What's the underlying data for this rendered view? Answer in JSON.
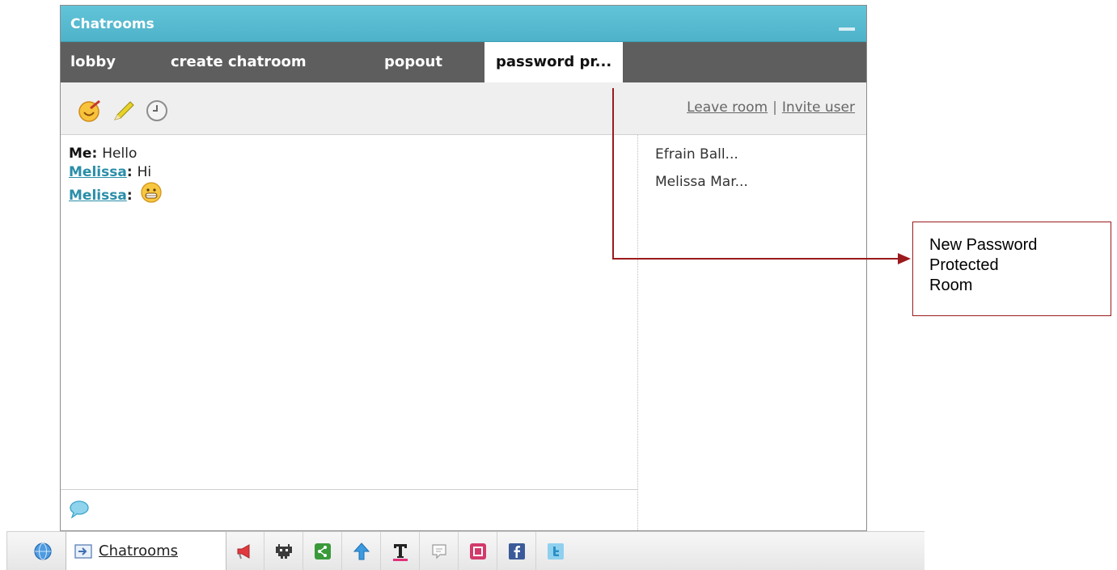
{
  "window": {
    "title": "Chatrooms",
    "tabs": [
      {
        "label": "lobby"
      },
      {
        "label": "create chatroom"
      },
      {
        "label": "popout"
      },
      {
        "label": "password pr..."
      }
    ],
    "toolbar": {
      "icons": [
        "smiley-icon",
        "pencil-icon",
        "clock-icon"
      ],
      "leave_room": "Leave room",
      "separator": "|",
      "invite_user": "Invite user"
    },
    "messages": [
      {
        "sender": "Me",
        "text": "Hello"
      },
      {
        "sender": "Melissa",
        "text": "Hi"
      },
      {
        "sender": "Melissa",
        "text": "",
        "emoji": "grin-emoji"
      }
    ],
    "users": [
      "Efrain Ball...",
      "Melissa Mar..."
    ]
  },
  "annotation": {
    "line1": "New Password",
    "line2": "Protected",
    "line3": "Room",
    "color": "#9b1a1d"
  },
  "bottom_bar": {
    "chatrooms_label": "Chatrooms",
    "icons": [
      "globe-icon",
      "announcement-icon",
      "games-icon",
      "share-icon",
      "upload-icon",
      "text-format-icon",
      "comments-icon",
      "save-icon",
      "facebook-icon",
      "twitter-icon"
    ]
  },
  "colors": {
    "titlebar": "#55b8cf",
    "tabbar": "#5e5e5e",
    "link": "#2a8ea8"
  }
}
